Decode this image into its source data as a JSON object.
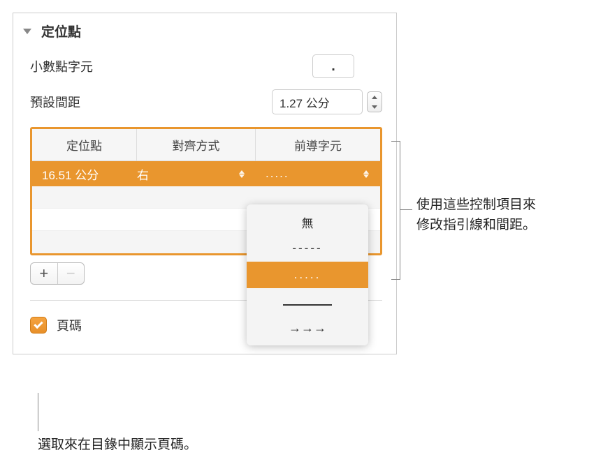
{
  "section": {
    "title": "定位點"
  },
  "decimal": {
    "label": "小數點字元",
    "value": "."
  },
  "spacing": {
    "label": "預設間距",
    "value": "1.27 公分"
  },
  "table": {
    "headers": {
      "tabstop": "定位點",
      "alignment": "對齊方式",
      "leader": "前導字元"
    },
    "row": {
      "tabstop": "16.51 公分",
      "alignment": "右",
      "leader": "....."
    }
  },
  "leader_options": {
    "none": "無",
    "dashes": "-----",
    "dots": ".....",
    "arrows": "→→→"
  },
  "page_number": {
    "label": "頁碼"
  },
  "callout1": {
    "line1": "使用這些控制項目來",
    "line2": "修改指引線和間距。"
  },
  "callout2": {
    "text": "選取來在目錄中顯示頁碼。"
  }
}
